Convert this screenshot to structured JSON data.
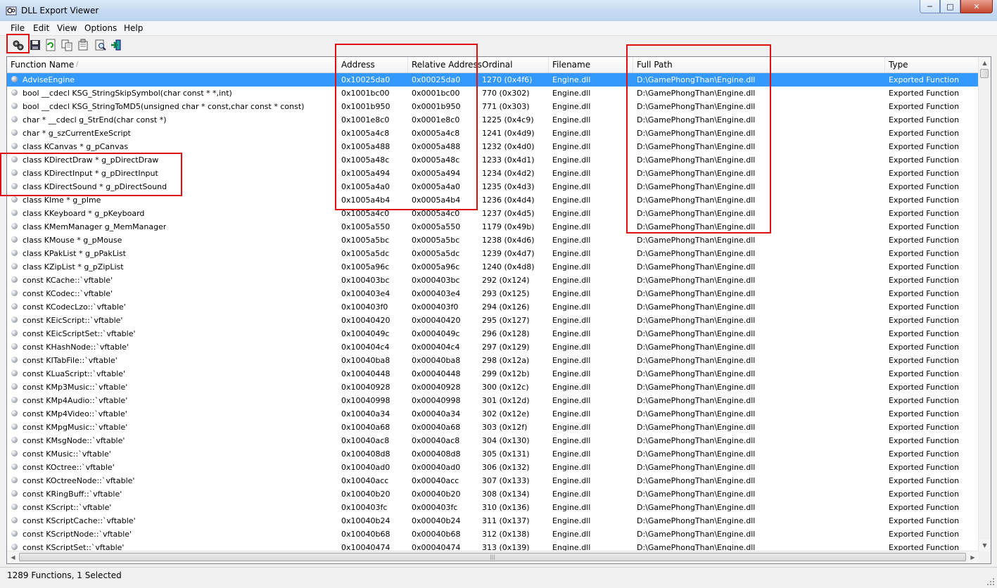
{
  "window": {
    "title": "DLL Export Viewer"
  },
  "menu": [
    "File",
    "Edit",
    "View",
    "Options",
    "Help"
  ],
  "toolbar": {
    "buttons": [
      "properties-icon",
      "save-icon",
      "refresh-icon",
      "copy-icon",
      "html-report-icon",
      "find-icon",
      "exit-icon"
    ]
  },
  "columns": [
    "Function Name",
    "Address",
    "Relative Address",
    "Ordinal",
    "Filename",
    "Full Path",
    "Type"
  ],
  "sort_indicator": "/",
  "rows": [
    {
      "name": "AdviseEngine",
      "address": "0x10025da0",
      "relative": "0x00025da0",
      "ordinal": "1270 (0x4f6)",
      "filename": "Engine.dll",
      "path": "D:\\GamePhongThan\\Engine.dll",
      "type": "Exported Function"
    },
    {
      "name": "bool __cdecl KSG_StringSkipSymbol(char const * *,int)",
      "address": "0x1001bc00",
      "relative": "0x0001bc00",
      "ordinal": "770 (0x302)",
      "filename": "Engine.dll",
      "path": "D:\\GamePhongThan\\Engine.dll",
      "type": "Exported Function"
    },
    {
      "name": "bool __cdecl KSG_StringToMD5(unsigned char * const,char const * const)",
      "address": "0x1001b950",
      "relative": "0x0001b950",
      "ordinal": "771 (0x303)",
      "filename": "Engine.dll",
      "path": "D:\\GamePhongThan\\Engine.dll",
      "type": "Exported Function"
    },
    {
      "name": "char * __cdecl g_StrEnd(char const *)",
      "address": "0x1001e8c0",
      "relative": "0x0001e8c0",
      "ordinal": "1225 (0x4c9)",
      "filename": "Engine.dll",
      "path": "D:\\GamePhongThan\\Engine.dll",
      "type": "Exported Function"
    },
    {
      "name": "char * g_szCurrentExeScript",
      "address": "0x1005a4c8",
      "relative": "0x0005a4c8",
      "ordinal": "1241 (0x4d9)",
      "filename": "Engine.dll",
      "path": "D:\\GamePhongThan\\Engine.dll",
      "type": "Exported Function"
    },
    {
      "name": "class KCanvas * g_pCanvas",
      "address": "0x1005a488",
      "relative": "0x0005a488",
      "ordinal": "1232 (0x4d0)",
      "filename": "Engine.dll",
      "path": "D:\\GamePhongThan\\Engine.dll",
      "type": "Exported Function"
    },
    {
      "name": "class KDirectDraw * g_pDirectDraw",
      "address": "0x1005a48c",
      "relative": "0x0005a48c",
      "ordinal": "1233 (0x4d1)",
      "filename": "Engine.dll",
      "path": "D:\\GamePhongThan\\Engine.dll",
      "type": "Exported Function"
    },
    {
      "name": "class KDirectInput * g_pDirectInput",
      "address": "0x1005a494",
      "relative": "0x0005a494",
      "ordinal": "1234 (0x4d2)",
      "filename": "Engine.dll",
      "path": "D:\\GamePhongThan\\Engine.dll",
      "type": "Exported Function"
    },
    {
      "name": "class KDirectSound * g_pDirectSound",
      "address": "0x1005a4a0",
      "relative": "0x0005a4a0",
      "ordinal": "1235 (0x4d3)",
      "filename": "Engine.dll",
      "path": "D:\\GamePhongThan\\Engine.dll",
      "type": "Exported Function"
    },
    {
      "name": "class KIme * g_pIme",
      "address": "0x1005a4b4",
      "relative": "0x0005a4b4",
      "ordinal": "1236 (0x4d4)",
      "filename": "Engine.dll",
      "path": "D:\\GamePhongThan\\Engine.dll",
      "type": "Exported Function"
    },
    {
      "name": "class KKeyboard * g_pKeyboard",
      "address": "0x1005a4c0",
      "relative": "0x0005a4c0",
      "ordinal": "1237 (0x4d5)",
      "filename": "Engine.dll",
      "path": "D:\\GamePhongThan\\Engine.dll",
      "type": "Exported Function"
    },
    {
      "name": "class KMemManager g_MemManager",
      "address": "0x1005a550",
      "relative": "0x0005a550",
      "ordinal": "1179 (0x49b)",
      "filename": "Engine.dll",
      "path": "D:\\GamePhongThan\\Engine.dll",
      "type": "Exported Function"
    },
    {
      "name": "class KMouse * g_pMouse",
      "address": "0x1005a5bc",
      "relative": "0x0005a5bc",
      "ordinal": "1238 (0x4d6)",
      "filename": "Engine.dll",
      "path": "D:\\GamePhongThan\\Engine.dll",
      "type": "Exported Function"
    },
    {
      "name": "class KPakList * g_pPakList",
      "address": "0x1005a5dc",
      "relative": "0x0005a5dc",
      "ordinal": "1239 (0x4d7)",
      "filename": "Engine.dll",
      "path": "D:\\GamePhongThan\\Engine.dll",
      "type": "Exported Function"
    },
    {
      "name": "class KZipList * g_pZipList",
      "address": "0x1005a96c",
      "relative": "0x0005a96c",
      "ordinal": "1240 (0x4d8)",
      "filename": "Engine.dll",
      "path": "D:\\GamePhongThan\\Engine.dll",
      "type": "Exported Function"
    },
    {
      "name": "const KCache::`vftable'",
      "address": "0x100403bc",
      "relative": "0x000403bc",
      "ordinal": "292 (0x124)",
      "filename": "Engine.dll",
      "path": "D:\\GamePhongThan\\Engine.dll",
      "type": "Exported Function"
    },
    {
      "name": "const KCodec::`vftable'",
      "address": "0x100403e4",
      "relative": "0x000403e4",
      "ordinal": "293 (0x125)",
      "filename": "Engine.dll",
      "path": "D:\\GamePhongThan\\Engine.dll",
      "type": "Exported Function"
    },
    {
      "name": "const KCodecLzo::`vftable'",
      "address": "0x100403f0",
      "relative": "0x000403f0",
      "ordinal": "294 (0x126)",
      "filename": "Engine.dll",
      "path": "D:\\GamePhongThan\\Engine.dll",
      "type": "Exported Function"
    },
    {
      "name": "const KEicScript::`vftable'",
      "address": "0x10040420",
      "relative": "0x00040420",
      "ordinal": "295 (0x127)",
      "filename": "Engine.dll",
      "path": "D:\\GamePhongThan\\Engine.dll",
      "type": "Exported Function"
    },
    {
      "name": "const KEicScriptSet::`vftable'",
      "address": "0x1004049c",
      "relative": "0x0004049c",
      "ordinal": "296 (0x128)",
      "filename": "Engine.dll",
      "path": "D:\\GamePhongThan\\Engine.dll",
      "type": "Exported Function"
    },
    {
      "name": "const KHashNode::`vftable'",
      "address": "0x100404c4",
      "relative": "0x000404c4",
      "ordinal": "297 (0x129)",
      "filename": "Engine.dll",
      "path": "D:\\GamePhongThan\\Engine.dll",
      "type": "Exported Function"
    },
    {
      "name": "const KITabFile::`vftable'",
      "address": "0x10040ba8",
      "relative": "0x00040ba8",
      "ordinal": "298 (0x12a)",
      "filename": "Engine.dll",
      "path": "D:\\GamePhongThan\\Engine.dll",
      "type": "Exported Function"
    },
    {
      "name": "const KLuaScript::`vftable'",
      "address": "0x10040448",
      "relative": "0x00040448",
      "ordinal": "299 (0x12b)",
      "filename": "Engine.dll",
      "path": "D:\\GamePhongThan\\Engine.dll",
      "type": "Exported Function"
    },
    {
      "name": "const KMp3Music::`vftable'",
      "address": "0x10040928",
      "relative": "0x00040928",
      "ordinal": "300 (0x12c)",
      "filename": "Engine.dll",
      "path": "D:\\GamePhongThan\\Engine.dll",
      "type": "Exported Function"
    },
    {
      "name": "const KMp4Audio::`vftable'",
      "address": "0x10040998",
      "relative": "0x00040998",
      "ordinal": "301 (0x12d)",
      "filename": "Engine.dll",
      "path": "D:\\GamePhongThan\\Engine.dll",
      "type": "Exported Function"
    },
    {
      "name": "const KMp4Video::`vftable'",
      "address": "0x10040a34",
      "relative": "0x00040a34",
      "ordinal": "302 (0x12e)",
      "filename": "Engine.dll",
      "path": "D:\\GamePhongThan\\Engine.dll",
      "type": "Exported Function"
    },
    {
      "name": "const KMpgMusic::`vftable'",
      "address": "0x10040a68",
      "relative": "0x00040a68",
      "ordinal": "303 (0x12f)",
      "filename": "Engine.dll",
      "path": "D:\\GamePhongThan\\Engine.dll",
      "type": "Exported Function"
    },
    {
      "name": "const KMsgNode::`vftable'",
      "address": "0x10040ac8",
      "relative": "0x00040ac8",
      "ordinal": "304 (0x130)",
      "filename": "Engine.dll",
      "path": "D:\\GamePhongThan\\Engine.dll",
      "type": "Exported Function"
    },
    {
      "name": "const KMusic::`vftable'",
      "address": "0x100408d8",
      "relative": "0x000408d8",
      "ordinal": "305 (0x131)",
      "filename": "Engine.dll",
      "path": "D:\\GamePhongThan\\Engine.dll",
      "type": "Exported Function"
    },
    {
      "name": "const KOctree::`vftable'",
      "address": "0x10040ad0",
      "relative": "0x00040ad0",
      "ordinal": "306 (0x132)",
      "filename": "Engine.dll",
      "path": "D:\\GamePhongThan\\Engine.dll",
      "type": "Exported Function"
    },
    {
      "name": "const KOctreeNode::`vftable'",
      "address": "0x10040acc",
      "relative": "0x00040acc",
      "ordinal": "307 (0x133)",
      "filename": "Engine.dll",
      "path": "D:\\GamePhongThan\\Engine.dll",
      "type": "Exported Function"
    },
    {
      "name": "const KRingBuff::`vftable'",
      "address": "0x10040b20",
      "relative": "0x00040b20",
      "ordinal": "308 (0x134)",
      "filename": "Engine.dll",
      "path": "D:\\GamePhongThan\\Engine.dll",
      "type": "Exported Function"
    },
    {
      "name": "const KScript::`vftable'",
      "address": "0x100403fc",
      "relative": "0x000403fc",
      "ordinal": "310 (0x136)",
      "filename": "Engine.dll",
      "path": "D:\\GamePhongThan\\Engine.dll",
      "type": "Exported Function"
    },
    {
      "name": "const KScriptCache::`vftable'",
      "address": "0x10040b24",
      "relative": "0x00040b24",
      "ordinal": "311 (0x137)",
      "filename": "Engine.dll",
      "path": "D:\\GamePhongThan\\Engine.dll",
      "type": "Exported Function"
    },
    {
      "name": "const KScriptNode::`vftable'",
      "address": "0x10040b68",
      "relative": "0x00040b68",
      "ordinal": "312 (0x138)",
      "filename": "Engine.dll",
      "path": "D:\\GamePhongThan\\Engine.dll",
      "type": "Exported Function"
    },
    {
      "name": "const KScriptSet::`vftable'",
      "address": "0x10040474",
      "relative": "0x00040474",
      "ordinal": "313 (0x139)",
      "filename": "Engine.dll",
      "path": "D:\\GamePhongThan\\Engine.dll",
      "type": "Exported Function"
    }
  ],
  "selected_row": 0,
  "status": "1289 Functions, 1 Selected",
  "colors": {
    "selection": "#3399ff",
    "highlight": "#e01010"
  }
}
